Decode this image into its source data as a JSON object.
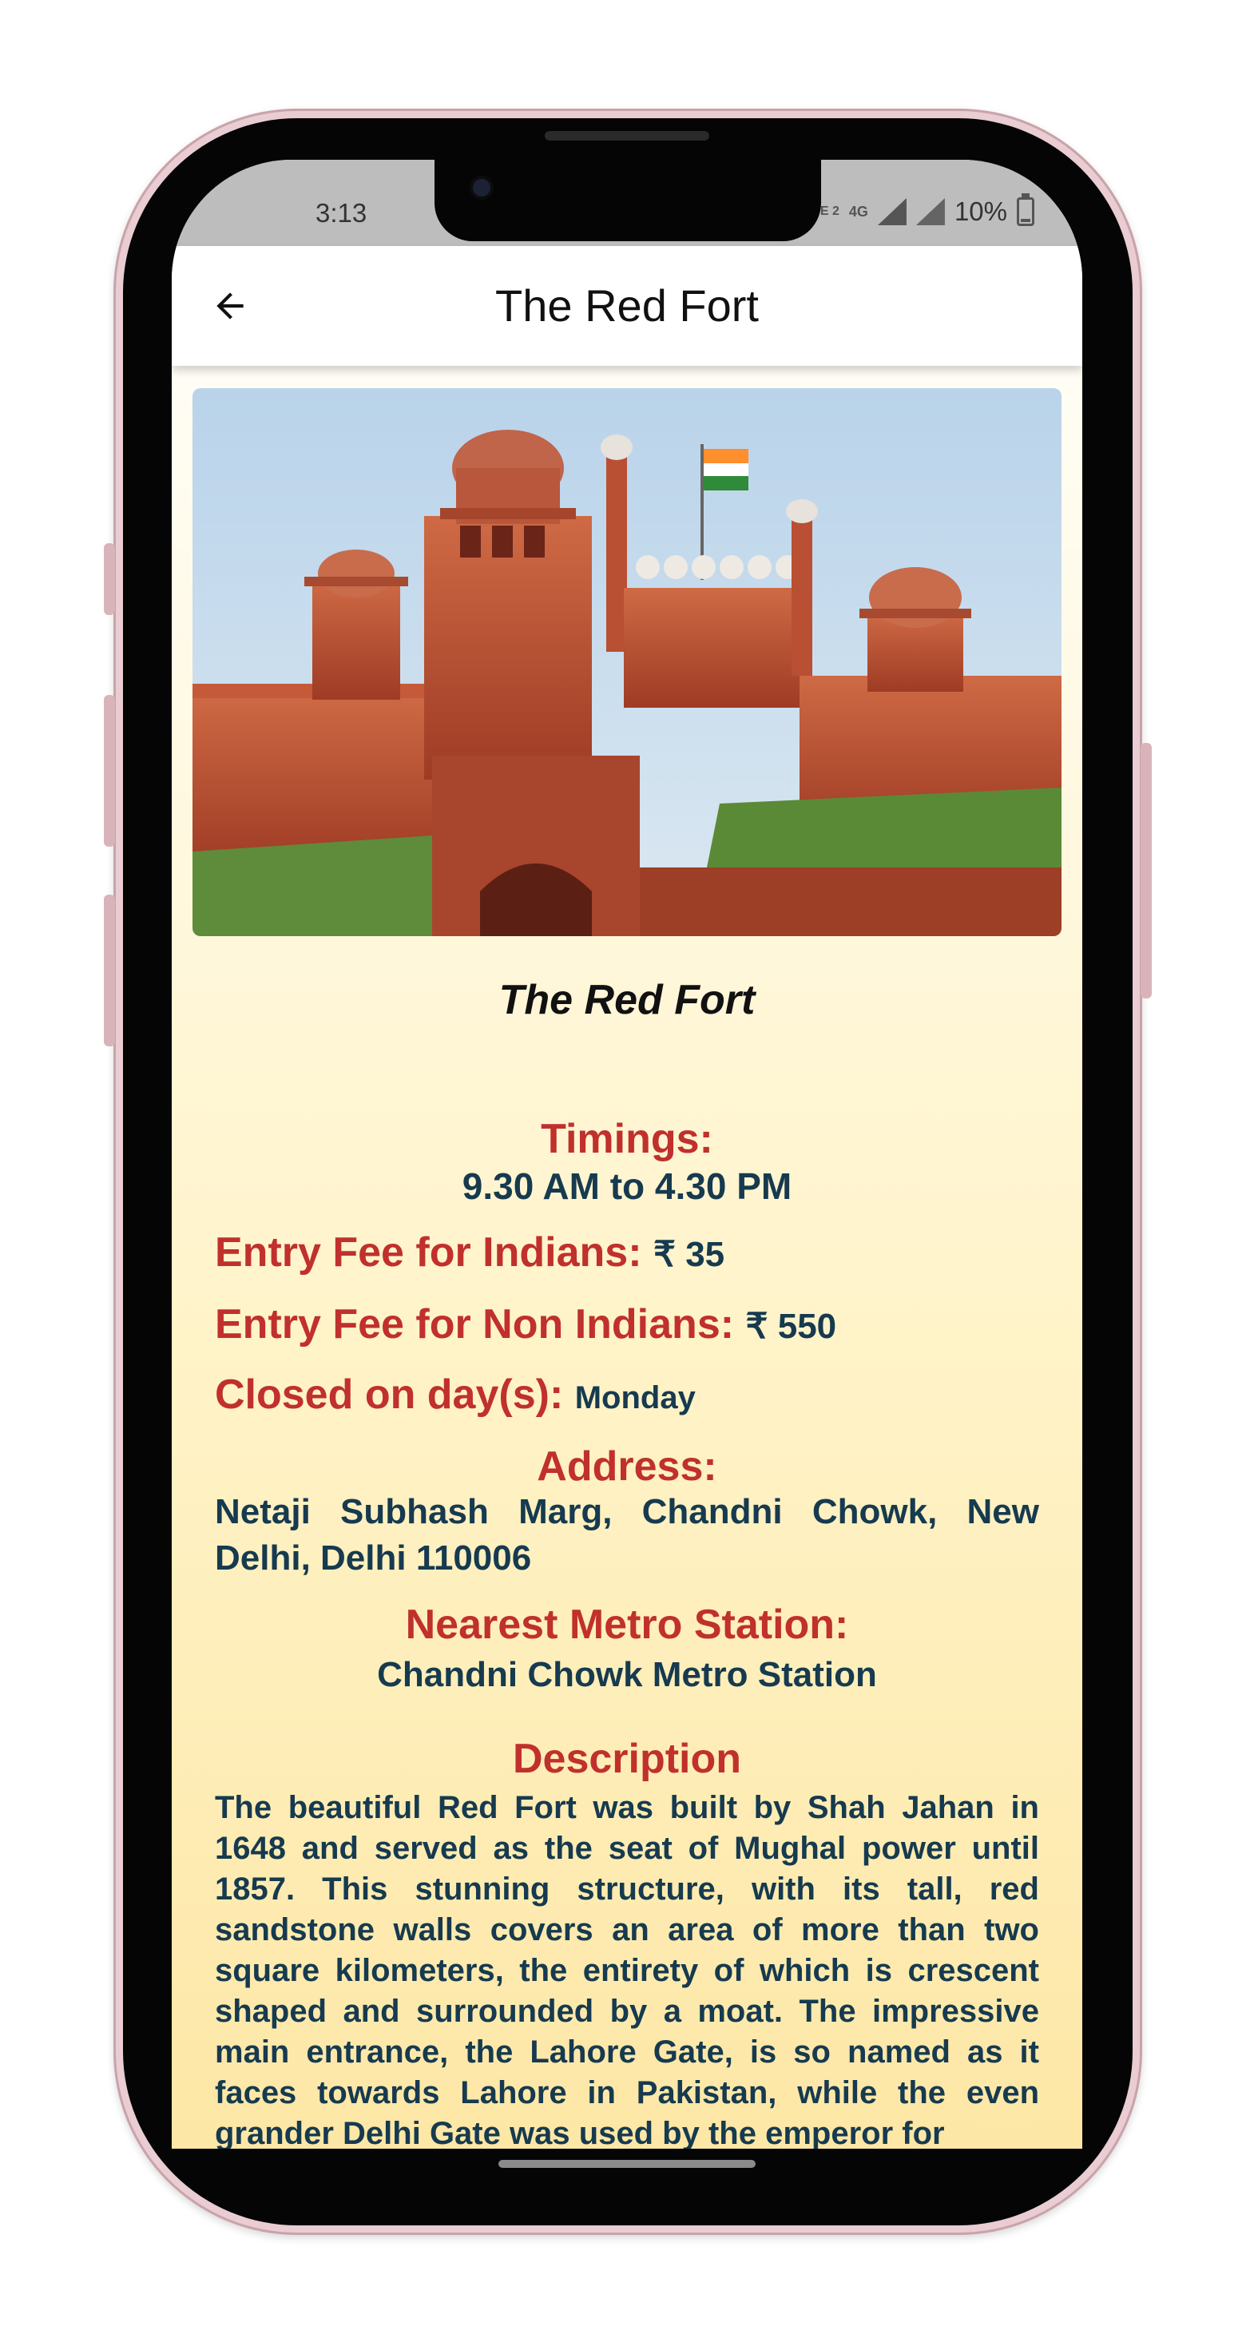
{
  "status_bar": {
    "time": "3:13",
    "network_label": "4G",
    "lte_label": "LTE 2",
    "battery": "10%"
  },
  "app_bar": {
    "back_icon": "arrow-left-icon",
    "title": "The Red Fort"
  },
  "place": {
    "image_name": "red-fort-photo",
    "title": "The Red Fort",
    "timings_label": "Timings:",
    "timings_value": "9.30 AM to 4.30 PM",
    "fee_indians_label": "Entry Fee for Indians:",
    "fee_indians_value": "₹ 35",
    "fee_non_indians_label": "Entry Fee for Non Indians:",
    "fee_non_indians_value": "₹ 550",
    "closed_label": "Closed on day(s):",
    "closed_value": "Monday",
    "address_label": "Address:",
    "address_value": "Netaji Subhash Marg, Chandni Chowk, New Delhi, Delhi 110006",
    "metro_label": "Nearest Metro Station:",
    "metro_value": "Chandni Chowk Metro Station",
    "description_label": "Description",
    "description_text": "The beautiful Red Fort was built by Shah Jahan in 1648 and served as the seat of Mughal power until 1857. This stunning structure, with its tall, red sandstone walls covers an area of more than two square kilometers, the entirety of which is crescent shaped and surrounded by a moat. The impressive main entrance, the Lahore Gate, is so named as it faces towards Lahore in Pakistan, while the even grander Delhi Gate was used by the emperor for"
  },
  "colors": {
    "label_red": "#c0302c",
    "value_navy": "#163a4f",
    "status_bar_bg": "#bdbdbd",
    "phone_frame": "#e9cdd2"
  }
}
